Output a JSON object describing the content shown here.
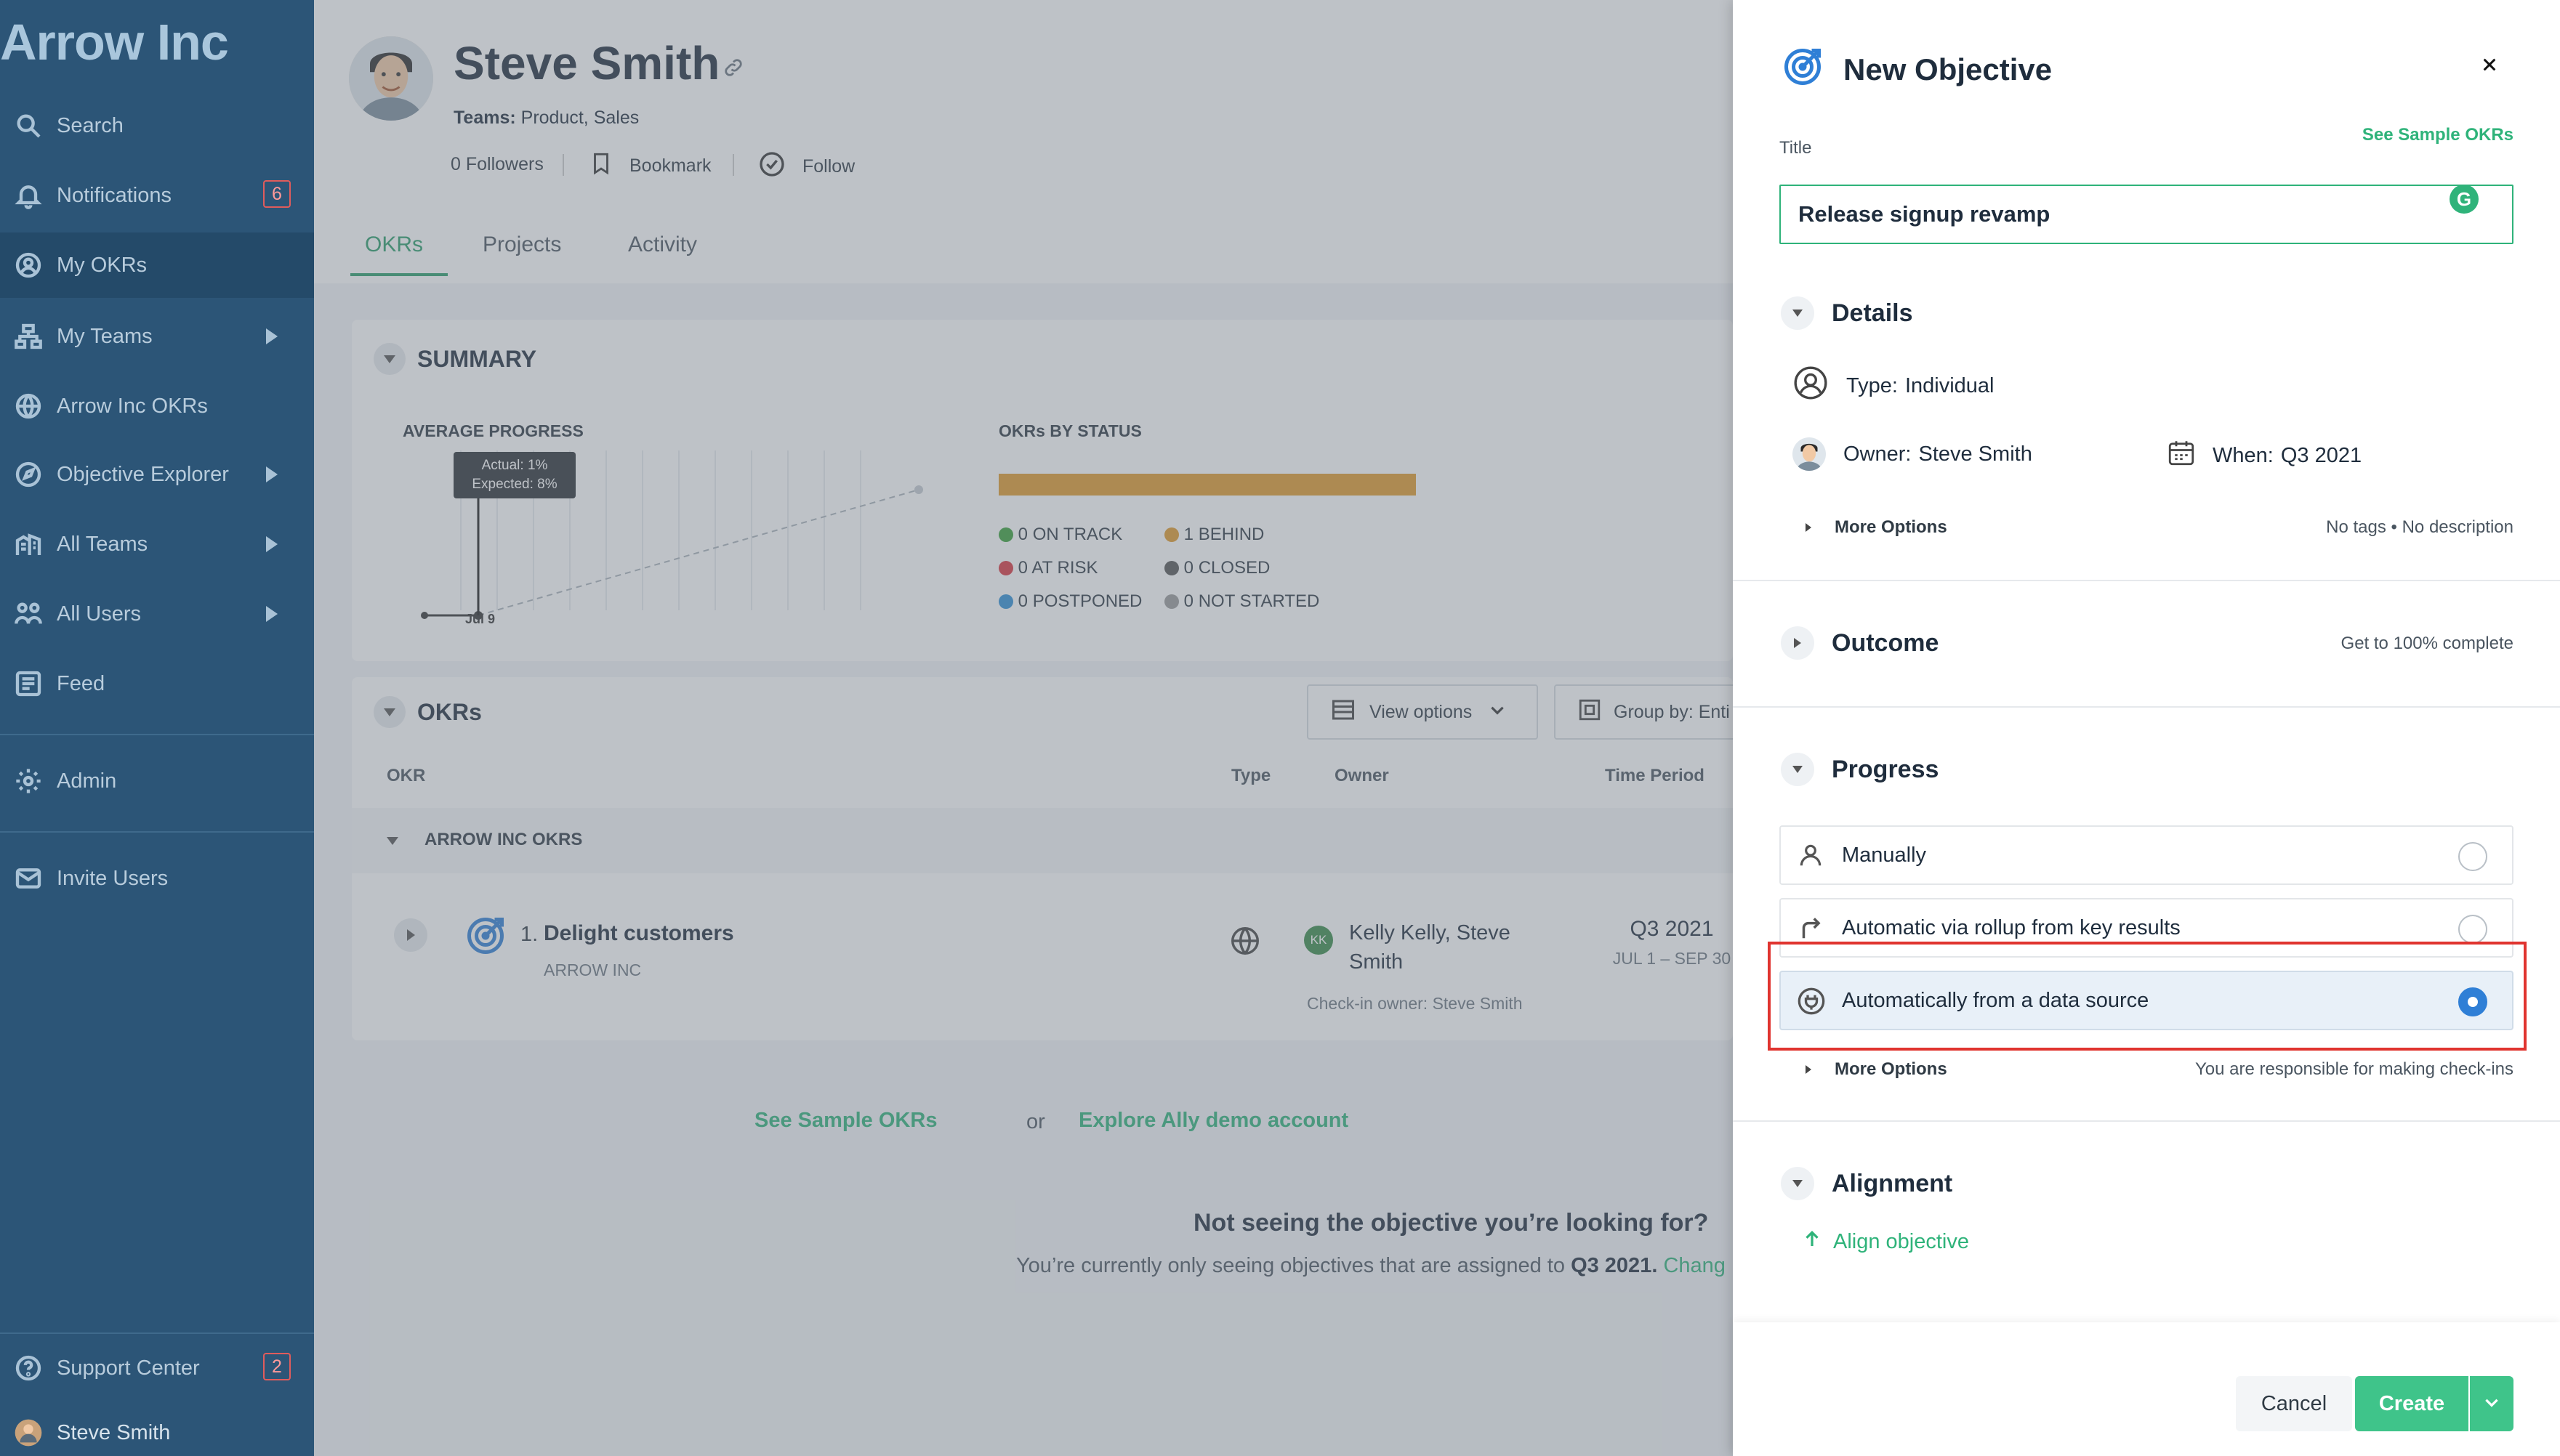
{
  "sidebar": {
    "brand": "Arrow Inc",
    "items": [
      {
        "label": "Search",
        "icon": "search-icon"
      },
      {
        "label": "Notifications",
        "icon": "bell-icon",
        "badge": "6"
      },
      {
        "label": "My OKRs",
        "icon": "user-circle-icon"
      },
      {
        "label": "My Teams",
        "icon": "org-chart-icon"
      },
      {
        "label": "Arrow Inc OKRs",
        "icon": "globe-icon"
      },
      {
        "label": "Objective Explorer",
        "icon": "compass-icon"
      },
      {
        "label": "All Teams",
        "icon": "building-icon"
      },
      {
        "label": "All Users",
        "icon": "users-icon"
      },
      {
        "label": "Feed",
        "icon": "feed-icon"
      },
      {
        "label": "Admin",
        "icon": "gear-icon"
      },
      {
        "label": "Invite Users",
        "icon": "mail-icon"
      },
      {
        "label": "Support Center",
        "icon": "help-icon",
        "badge": "2"
      },
      {
        "label": "Steve Smith",
        "icon": "avatar"
      }
    ]
  },
  "profile": {
    "name": "Steve Smith",
    "teams_label": "Teams:",
    "teams": "Product, Sales",
    "followers": "0 Followers",
    "bookmark": "Bookmark",
    "follow": "Follow",
    "tabs": [
      "OKRs",
      "Projects",
      "Activity"
    ]
  },
  "summary": {
    "title": "SUMMARY",
    "avg_progress_label": "AVERAGE PROGRESS",
    "tooltip_actual": "Actual: 1%",
    "tooltip_expected": "Expected: 8%",
    "x_tick": "Jul 9",
    "by_status_label": "OKRs BY STATUS",
    "statuses": [
      {
        "label": "0 ON TRACK",
        "color": "#3aa03a"
      },
      {
        "label": "1 BEHIND",
        "color": "#e09a2a"
      },
      {
        "label": "0 AT RISK",
        "color": "#d9363e"
      },
      {
        "label": "0 CLOSED",
        "color": "#555555"
      },
      {
        "label": "0 POSTPONED",
        "color": "#2f8fd6"
      },
      {
        "label": "0 NOT STARTED",
        "color": "#9a9a9a"
      }
    ]
  },
  "okrs": {
    "title": "OKRs",
    "view_options": "View options",
    "group_by": "Group by: Enti",
    "columns": [
      "OKR",
      "Type",
      "Owner",
      "Time Period"
    ],
    "group_label": "ARROW INC OKRS",
    "row": {
      "number": "1.",
      "title": "Delight customers",
      "subtitle": "ARROW INC",
      "owner": "Kelly Kelly, Steve Smith",
      "owner_initials": "KK",
      "checkin_owner": "Check-in owner: Steve Smith",
      "period": "Q3 2021",
      "period_range": "JUL 1 – SEP 30"
    }
  },
  "footer": {
    "see_sample": "See Sample OKRs",
    "or": "or",
    "explore": "Explore Ally demo account",
    "not_seeing": "Not seeing the objective you’re looking for?",
    "only_seeing": "You’re currently only seeing objectives that are assigned to",
    "period": "Q3 2021.",
    "change": "Chang"
  },
  "panel": {
    "title": "New Objective",
    "title_label": "Title",
    "see_sample": "See Sample OKRs",
    "title_value": "Release signup revamp",
    "details": "Details",
    "type_label": "Type:",
    "type_value": "Individual",
    "owner_label": "Owner:",
    "owner_value": "Steve Smith",
    "when_label": "When:",
    "when_value": "Q3 2021",
    "more_options": "More Options",
    "no_tags": "No tags • No description",
    "outcome": "Outcome",
    "outcome_hint": "Get to 100% complete",
    "progress": "Progress",
    "progress_options": [
      {
        "label": "Manually",
        "selected": false
      },
      {
        "label": "Automatic via rollup from key results",
        "selected": false
      },
      {
        "label": "Automatically from a data source",
        "selected": true
      }
    ],
    "progress_more": "More Options",
    "progress_hint": "You are responsible for making check-ins",
    "alignment": "Alignment",
    "align_objective": "Align objective",
    "cancel": "Cancel",
    "create": "Create"
  },
  "colors": {
    "sidebar": "#2c5577",
    "accent_green": "#2fb37a",
    "primary_blue": "#2f7fd6",
    "highlight_red": "#e0342f"
  }
}
